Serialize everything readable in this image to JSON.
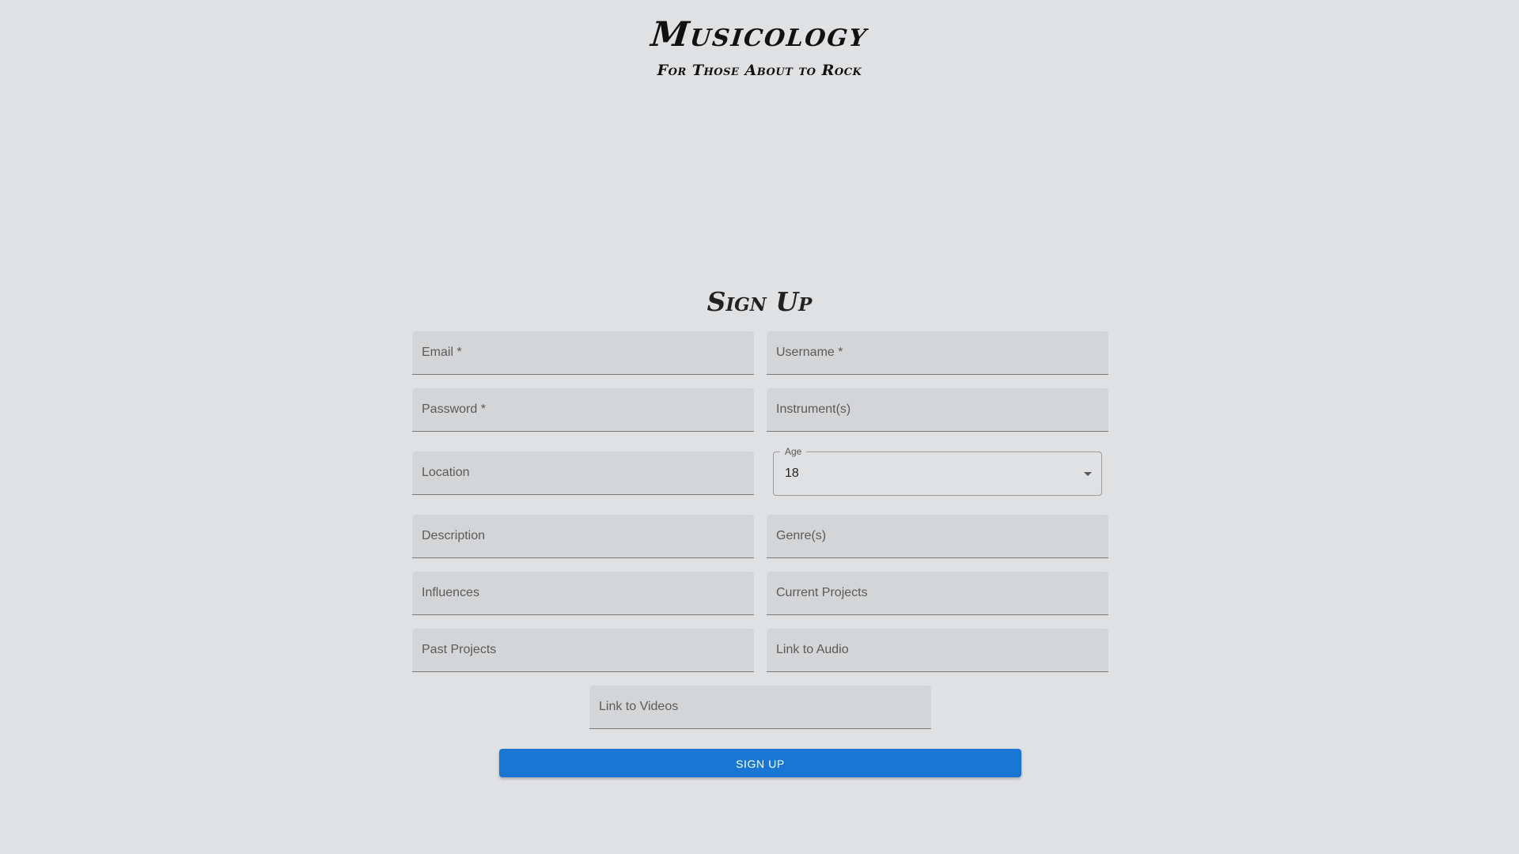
{
  "header": {
    "title": "Musicology",
    "subtitle": "For Those About to Rock"
  },
  "form": {
    "heading": "Sign Up",
    "fields": {
      "email": "Email *",
      "username": "Username *",
      "password": "Password *",
      "instruments": "Instrument(s)",
      "location": "Location",
      "description": "Description",
      "genres": "Genre(s)",
      "influences": "Influences",
      "current_projects": "Current Projects",
      "past_projects": "Past Projects",
      "link_audio": "Link to Audio",
      "link_videos": "Link to Videos"
    },
    "age": {
      "label": "Age",
      "value": "18"
    },
    "submit_label": "SIGN UP"
  },
  "colors": {
    "background": "#e0e1e3",
    "field_fill": "#d4d5d7",
    "primary": "#1976d2"
  }
}
